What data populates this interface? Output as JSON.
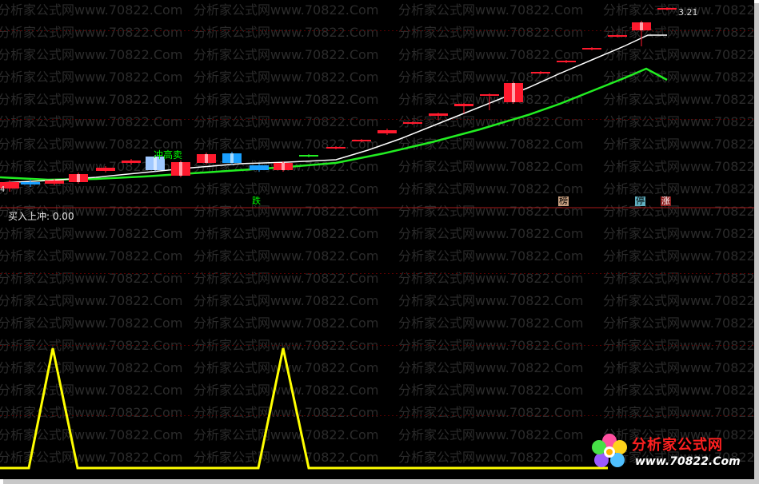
{
  "watermark_text": "分析家公式网www.70822.Com",
  "price_high_label": "3.21",
  "first_bar_label": "4",
  "annotation_sell": "冲高卖",
  "indicator_label": "买入上冲: 0.00",
  "signals": {
    "die": "跌",
    "bang": "榜",
    "ting": "停",
    "zhang": "涨"
  },
  "logo": {
    "title": "分析家公式网",
    "url": "www.70822.Com"
  },
  "colors": {
    "background": "#000000",
    "bull": "#ff1a2e",
    "bear": "#1aa0ff",
    "ma_fast": "#ffffff",
    "ma_slow": "#22ee22",
    "indicator": "#ffff00",
    "grid": "#7a0000"
  }
}
